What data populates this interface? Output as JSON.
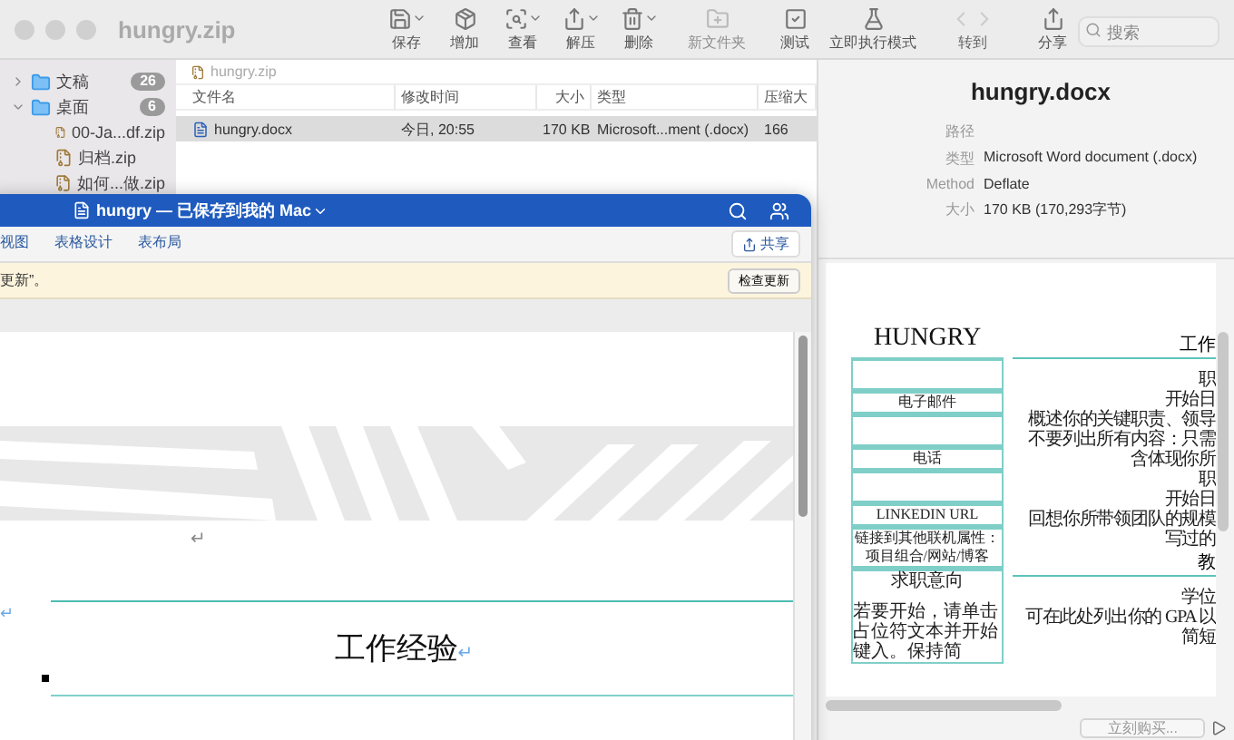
{
  "archive_window": {
    "title": "hungry.zip",
    "toolbar": [
      {
        "label": "保存",
        "kind": "save",
        "menu": true,
        "disabled": false
      },
      {
        "label": "增加",
        "kind": "add",
        "menu": false,
        "disabled": false
      },
      {
        "label": "查看",
        "kind": "view",
        "menu": true,
        "disabled": false
      },
      {
        "label": "解压",
        "kind": "extract",
        "menu": true,
        "disabled": false
      },
      {
        "label": "删除",
        "kind": "delete",
        "menu": true,
        "disabled": false
      },
      {
        "label": "新文件夹",
        "kind": "folder",
        "menu": false,
        "disabled": true
      },
      {
        "label": "测试",
        "kind": "test",
        "menu": false,
        "disabled": false
      },
      {
        "label": "立即执行模式",
        "kind": "mode",
        "menu": false,
        "disabled": false
      },
      {
        "label": "转到",
        "kind": "nav"
      },
      {
        "label": "分享",
        "kind": "share",
        "menu": false,
        "disabled": false
      }
    ],
    "search": {
      "placeholder": "搜索"
    },
    "sidebar": {
      "items": [
        {
          "label": "文稿",
          "badge": "26",
          "expanded": false
        },
        {
          "label": "桌面",
          "badge": "6",
          "expanded": true,
          "children": [
            {
              "label": "00-Ja...df.zip"
            },
            {
              "label": "归档.zip"
            },
            {
              "label": "如何...做.zip"
            }
          ]
        }
      ]
    },
    "breadcrumb": "hungry.zip",
    "columns": [
      "文件名",
      "修改时间",
      "大小",
      "类型",
      "压缩大"
    ],
    "rows": [
      {
        "selected": true,
        "cells": [
          "hungry.docx",
          "今日, 20:55",
          "170 KB",
          "Microsoft...ment (.docx)",
          "166"
        ]
      }
    ],
    "info": {
      "title": "hungry.docx",
      "fields": [
        {
          "label": "路径"
        },
        {
          "label": "类型",
          "value": "Microsoft Word document (.docx)"
        },
        {
          "label": "Method",
          "value": "Deflate"
        },
        {
          "label": "大小",
          "value": "170 KB (170,293字节)"
        }
      ]
    },
    "preview": {
      "name": "HUNGRY",
      "left_rows": [
        {
          "kind": "blank"
        },
        {
          "kind": "label",
          "text": "电子邮件"
        },
        {
          "kind": "blank"
        },
        {
          "kind": "label",
          "text": "电话"
        },
        {
          "kind": "blank"
        },
        {
          "kind": "label",
          "text": "LINKEDIN URL"
        },
        {
          "kind": "label",
          "text": "链接到其他联机属性：项目组合/网站/博客"
        },
        {
          "kind": "section",
          "text": "求职意向",
          "body": "若要开始，请单击占位符文本并开始键入。保持简"
        }
      ],
      "right_lines": [
        {
          "kind": "heading",
          "text": "工作"
        },
        {
          "kind": "text",
          "text": "职"
        },
        {
          "kind": "text",
          "text": "开始日"
        },
        {
          "kind": "text",
          "text": "概述你的关键职责、领导"
        },
        {
          "kind": "text",
          "text": "不要列出所有内容：只需"
        },
        {
          "kind": "text",
          "text": "含体现你所"
        },
        {
          "kind": "text",
          "text": "职"
        },
        {
          "kind": "text",
          "text": "开始日"
        },
        {
          "kind": "text",
          "text": "回想你所带领团队的规模"
        },
        {
          "kind": "text",
          "text": "写过的"
        },
        {
          "kind": "heading",
          "text": "教"
        },
        {
          "kind": "text",
          "text": "学位"
        },
        {
          "kind": "text",
          "text": "可在此处列出你的 GPA 以"
        },
        {
          "kind": "text",
          "text": "简短"
        }
      ]
    },
    "buy_button": "立刻购买..."
  },
  "word_window": {
    "title": "hungry — 已保存到我的 Mac",
    "tabs": [
      {
        "label": "视图",
        "selected": false
      },
      {
        "label": "表格设计",
        "selected": false
      },
      {
        "label": "表布局",
        "selected": false
      }
    ],
    "share_button": "共享",
    "notice": {
      "message": "更新”。",
      "button": "检查更新"
    },
    "document": {
      "marks": [
        "↵",
        "↵"
      ],
      "heading": "工作经验",
      "heading_mark": "↵"
    }
  }
}
